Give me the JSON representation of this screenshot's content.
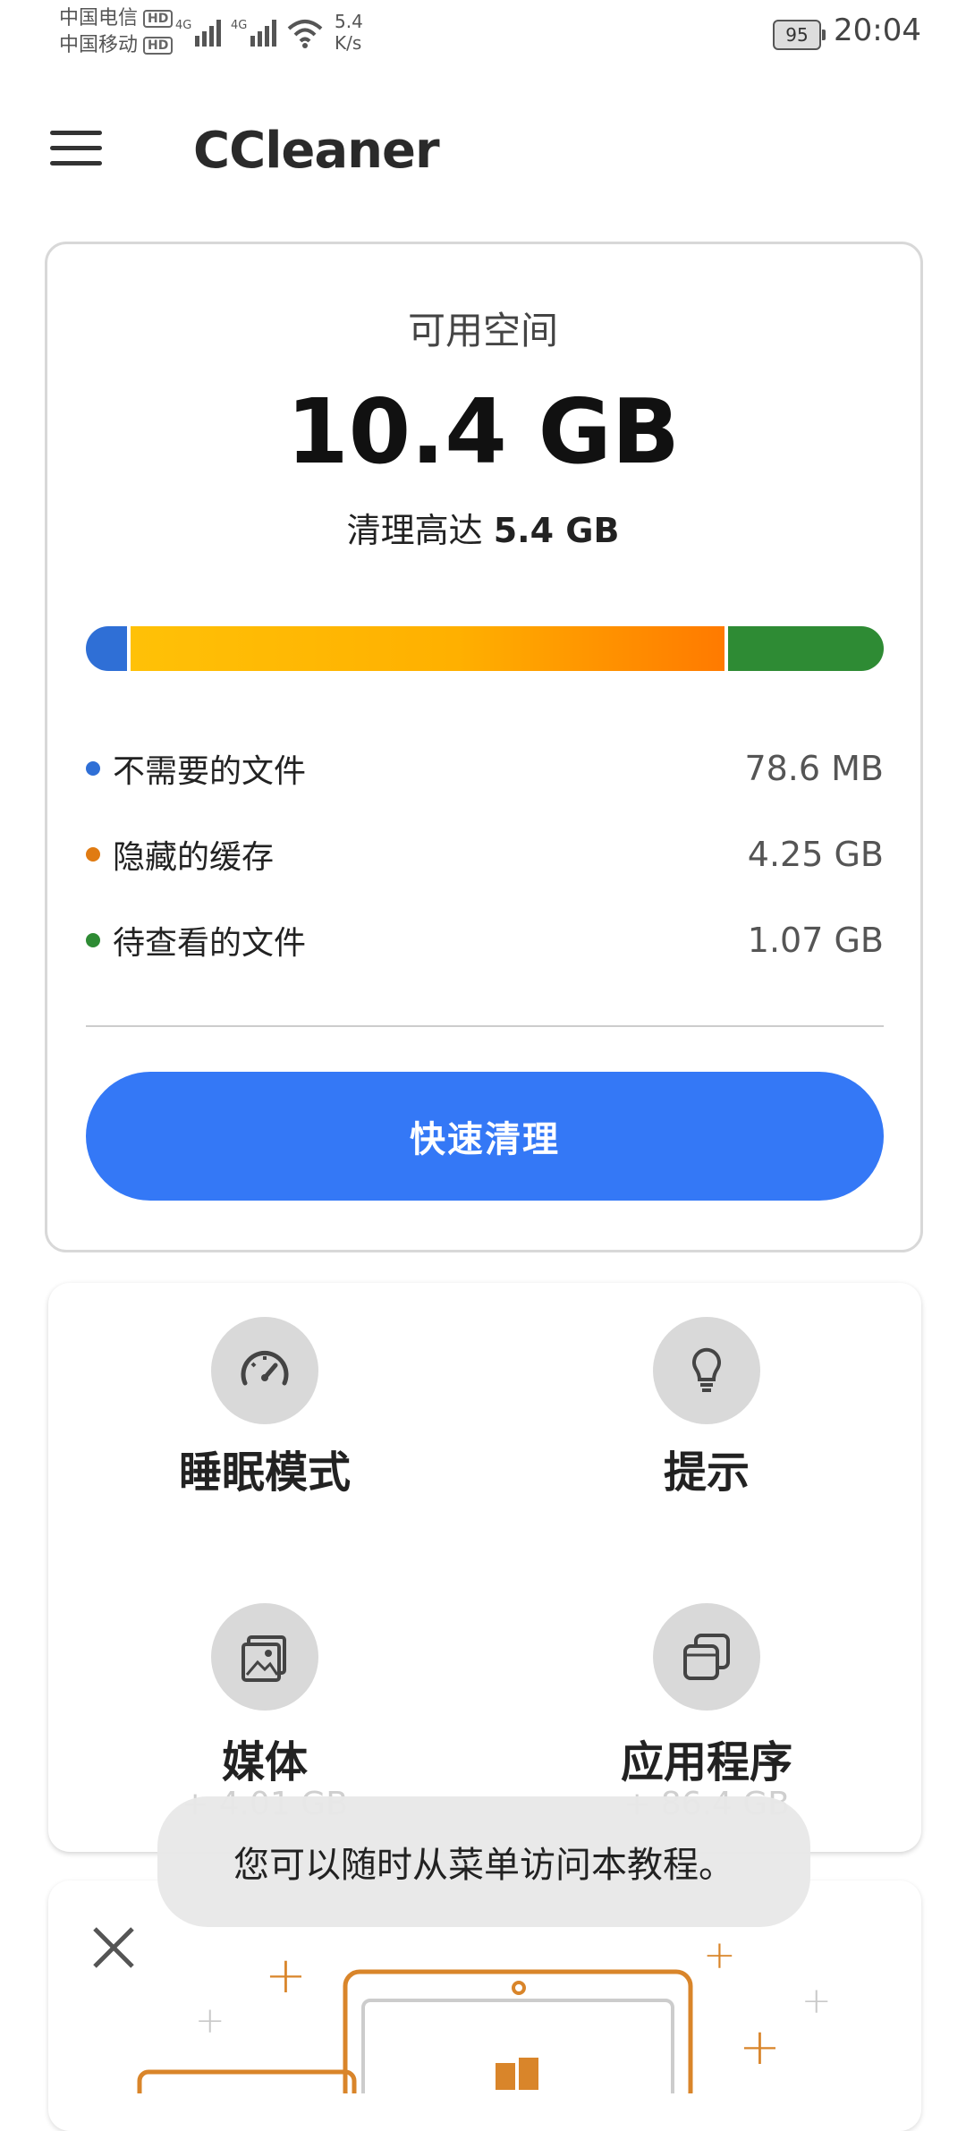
{
  "status_bar": {
    "carrier1": "中国电信",
    "carrier2": "中国移动",
    "hd_badge": "HD",
    "net_type": "4G",
    "speed_value": "5.4",
    "speed_unit": "K/s",
    "battery": "95",
    "time": "20:04"
  },
  "app_bar": {
    "title": "CCleaner"
  },
  "storage": {
    "label": "可用空间",
    "value": "10.4 GB",
    "clean_prefix": "清理高达",
    "clean_amount": "5.4 GB",
    "bar_fractions": [
      0.055,
      0.745,
      0.2
    ],
    "items": [
      {
        "label": "不需要的文件",
        "value": "78.6 MB",
        "color": "#2f6fd6"
      },
      {
        "label": "隐藏的缓存",
        "value": "4.25 GB",
        "color": "#e07b12"
      },
      {
        "label": "待查看的文件",
        "value": "1.07 GB",
        "color": "#2e8b34"
      }
    ],
    "button_label": "快速清理"
  },
  "features": [
    {
      "label": "睡眠模式",
      "icon": "speedometer-icon"
    },
    {
      "label": "提示",
      "icon": "lightbulb-icon"
    },
    {
      "label": "媒体",
      "sub": "+ 4.01 GB",
      "icon": "image-icon"
    },
    {
      "label": "应用程序",
      "sub": "+ 86.4 GB",
      "icon": "apps-icon"
    }
  ],
  "toast": {
    "text": "您可以随时从菜单访问本教程。"
  },
  "colors": {
    "primary": "#3478f6",
    "accent_orange": "#d9852a"
  }
}
